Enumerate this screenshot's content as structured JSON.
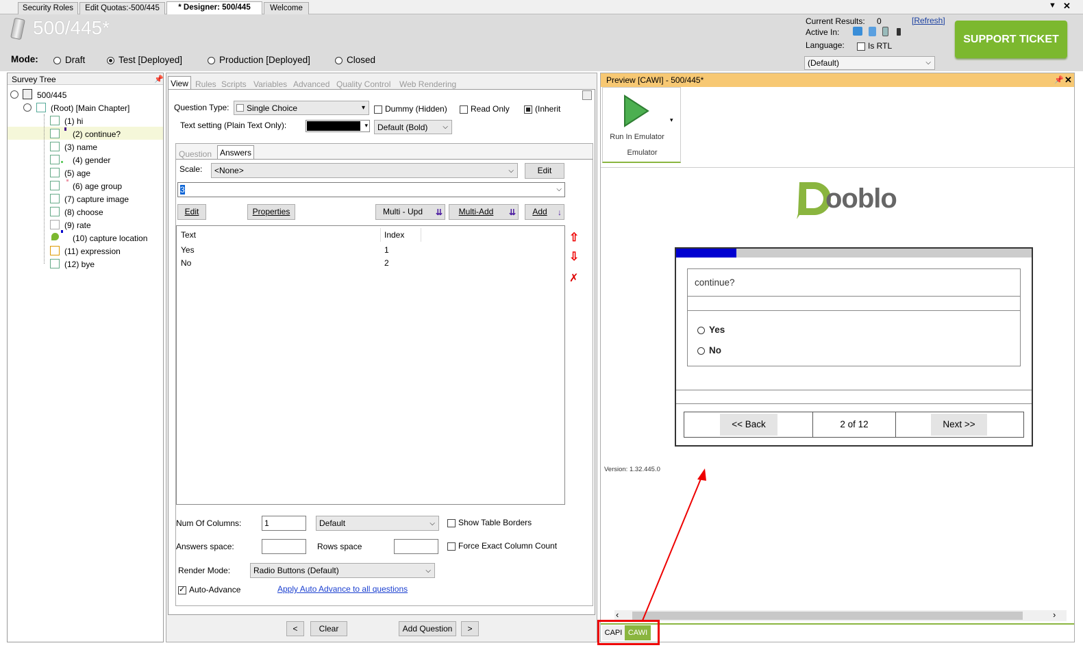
{
  "tabs": [
    "Security Roles",
    "Edit Quotas:-500/445",
    "* Designer: 500/445",
    "Welcome"
  ],
  "header": {
    "title": "500/445*",
    "mode_label": "Mode:",
    "modes": [
      "Draft",
      "Test [Deployed]",
      "Production [Deployed]",
      "Closed"
    ],
    "current_results_label": "Current Results:",
    "current_results_value": "0",
    "refresh_label": "[Refresh]",
    "active_in_label": "Active In:",
    "language_label": "Language:",
    "is_rtl_label": "Is RTL",
    "language_value": "(Default)",
    "support_ticket": "SUPPORT TICKET"
  },
  "survey_tree": {
    "title": "Survey Tree",
    "root": "500/445",
    "chapter": "(Root) [Main Chapter]",
    "items": [
      "(1) hi",
      "(2) continue?",
      "(3) name",
      "(4) gender",
      "(5) age",
      "(6) age group",
      "(7) capture image",
      "(8) choose",
      "(9) rate",
      "(10) capture location",
      "(11) expression",
      "(12) bye"
    ]
  },
  "designer": {
    "tabs": [
      "View",
      "Rules",
      "Scripts",
      "Variables",
      "Advanced",
      "Quality Control",
      "Web Rendering"
    ],
    "question_type_label": "Question Type:",
    "question_type_value": "Single Choice",
    "dummy_label": "Dummy (Hidden)",
    "read_only_label": "Read Only",
    "inherit_label": "(Inherit",
    "text_setting_label": "Text setting (Plain Text Only):",
    "text_style_value": "Default (Bold)",
    "subtabs": [
      "Question",
      "Answers"
    ],
    "scale_label": "Scale:",
    "scale_value": "<None>",
    "edit_btn": "Edit",
    "search_value": "3",
    "buttons": {
      "edit": "Edit",
      "properties": "Properties",
      "multi_upd": "Multi - Upd",
      "multi_add": "Multi-Add",
      "add": "Add"
    },
    "answer_columns": [
      "Text",
      "Index"
    ],
    "answers": [
      {
        "text": "Yes",
        "index": "1"
      },
      {
        "text": "No",
        "index": "2"
      }
    ],
    "num_columns_label": "Num Of Columns:",
    "num_columns_value": "1",
    "columns_mode_value": "Default",
    "show_borders_label": "Show Table Borders",
    "answers_space_label": "Answers space:",
    "rows_space_label": "Rows space",
    "force_exact_label": "Force Exact Column Count",
    "render_mode_label": "Render Mode:",
    "render_mode_value": "Radio Buttons (Default)",
    "auto_advance_label": "Auto-Advance",
    "apply_auto_advance": "Apply Auto Advance to all questions",
    "bottom": {
      "prev": "<",
      "clear": "Clear",
      "add_question": "Add Question",
      "next": ">"
    }
  },
  "preview": {
    "title": "Preview [CAWI] - 500/445*",
    "run_label": "Run In Emulator",
    "group_label": "Emulator",
    "logo": "Dooblo",
    "question": "continue?",
    "options": [
      "Yes",
      "No"
    ],
    "back": "<< Back",
    "page": "2 of 12",
    "next": "Next >>",
    "version": "Version: 1.32.445.0",
    "progress_fraction": 0.17,
    "mode_tabs": [
      "CAPI",
      "CAWI"
    ]
  },
  "colors": {
    "accent": "#8ab53f",
    "support": "#7cb82f",
    "preview_header": "#f7c873",
    "progress": "#0000d0",
    "annotation": "#e00000"
  }
}
